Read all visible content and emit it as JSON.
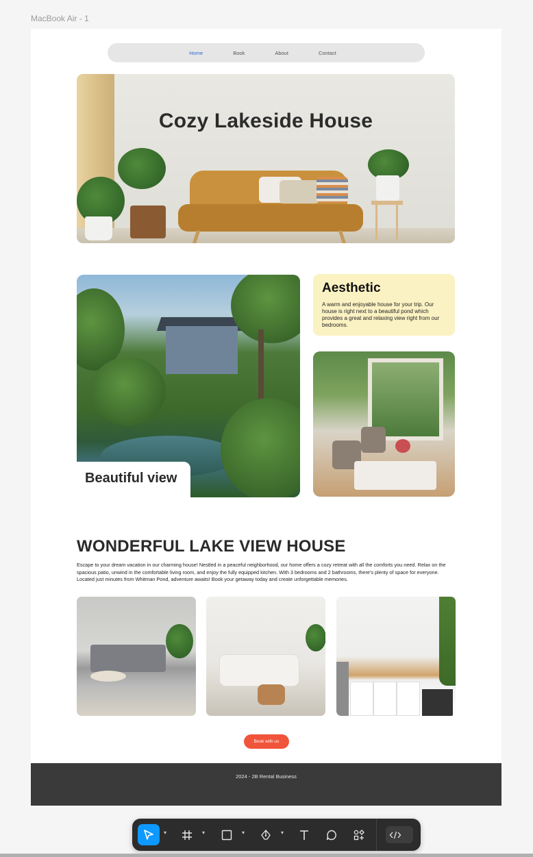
{
  "frame": {
    "label": "MacBook Air - 1"
  },
  "nav": {
    "items": [
      "Home",
      "Book",
      "About",
      "Contact"
    ],
    "active": "Home",
    "active_color": "#2e6ad6"
  },
  "hero": {
    "title": "Cozy Lakeside House"
  },
  "gallery": {
    "view_caption": "Beautiful view",
    "aesthetic_title": "Aesthetic",
    "aesthetic_text": "A warm and enjoyable house for your trip. Our house is right next to a beautiful pond which provides a great and relaxing view right from our bedrooms.",
    "aesthetic_bg": "#fbf2c3"
  },
  "section": {
    "title": "WONDERFUL LAKE VIEW HOUSE",
    "text": "Escape to your dream vacation in our charming house! Nestled in a peaceful neighborhood, our home offers a cozy retreat with all the comforts you need. Relax on the spacious patio, unwind in the comfortable living room, and enjoy the fully equipped kitchen. With 3 bedrooms and 2 bathrooms, there's plenty of space for everyone. Located just minutes from Whitman Pond, adventure awaits! Book your getaway today and create unforgettable memories."
  },
  "cta": {
    "label": "Book with us",
    "color": "#f0543a"
  },
  "footer": {
    "text": "2024 - 2B Rental Business"
  },
  "toolbar": {
    "tools": [
      "move-tool-icon",
      "frame-tool-icon",
      "rectangle-tool-icon",
      "pen-tool-icon",
      "text-tool-icon",
      "comment-tool-icon",
      "components-icon",
      "dev-mode-icon"
    ],
    "active_tool": "move-tool-icon",
    "accent": "#0d99ff"
  }
}
